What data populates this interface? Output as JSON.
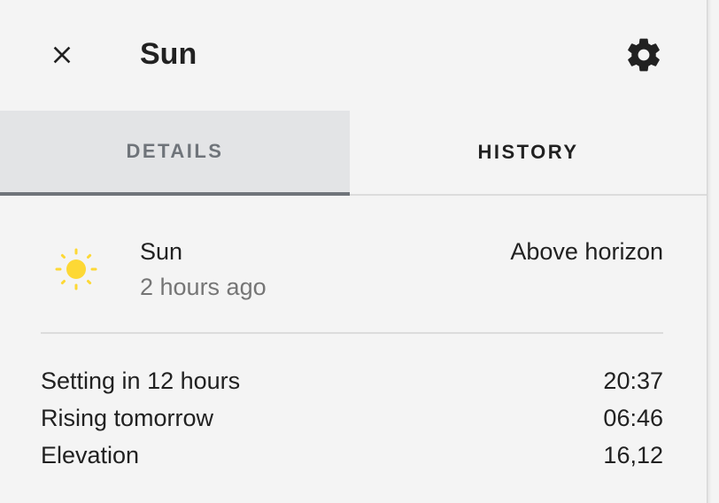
{
  "header": {
    "title": "Sun"
  },
  "tabs": [
    {
      "label": "DETAILS",
      "active": true
    },
    {
      "label": "HISTORY",
      "active": false
    }
  ],
  "entity": {
    "icon": "sun-icon",
    "icon_color": "#fdd835",
    "name": "Sun",
    "last_changed": "2 hours ago",
    "state": "Above horizon"
  },
  "attributes": [
    {
      "label": "Setting in 12 hours",
      "value": "20:37"
    },
    {
      "label": "Rising tomorrow",
      "value": "06:46"
    },
    {
      "label": "Elevation",
      "value": "16,12"
    }
  ],
  "icons": {
    "close": "close-icon",
    "settings": "gear-icon"
  }
}
